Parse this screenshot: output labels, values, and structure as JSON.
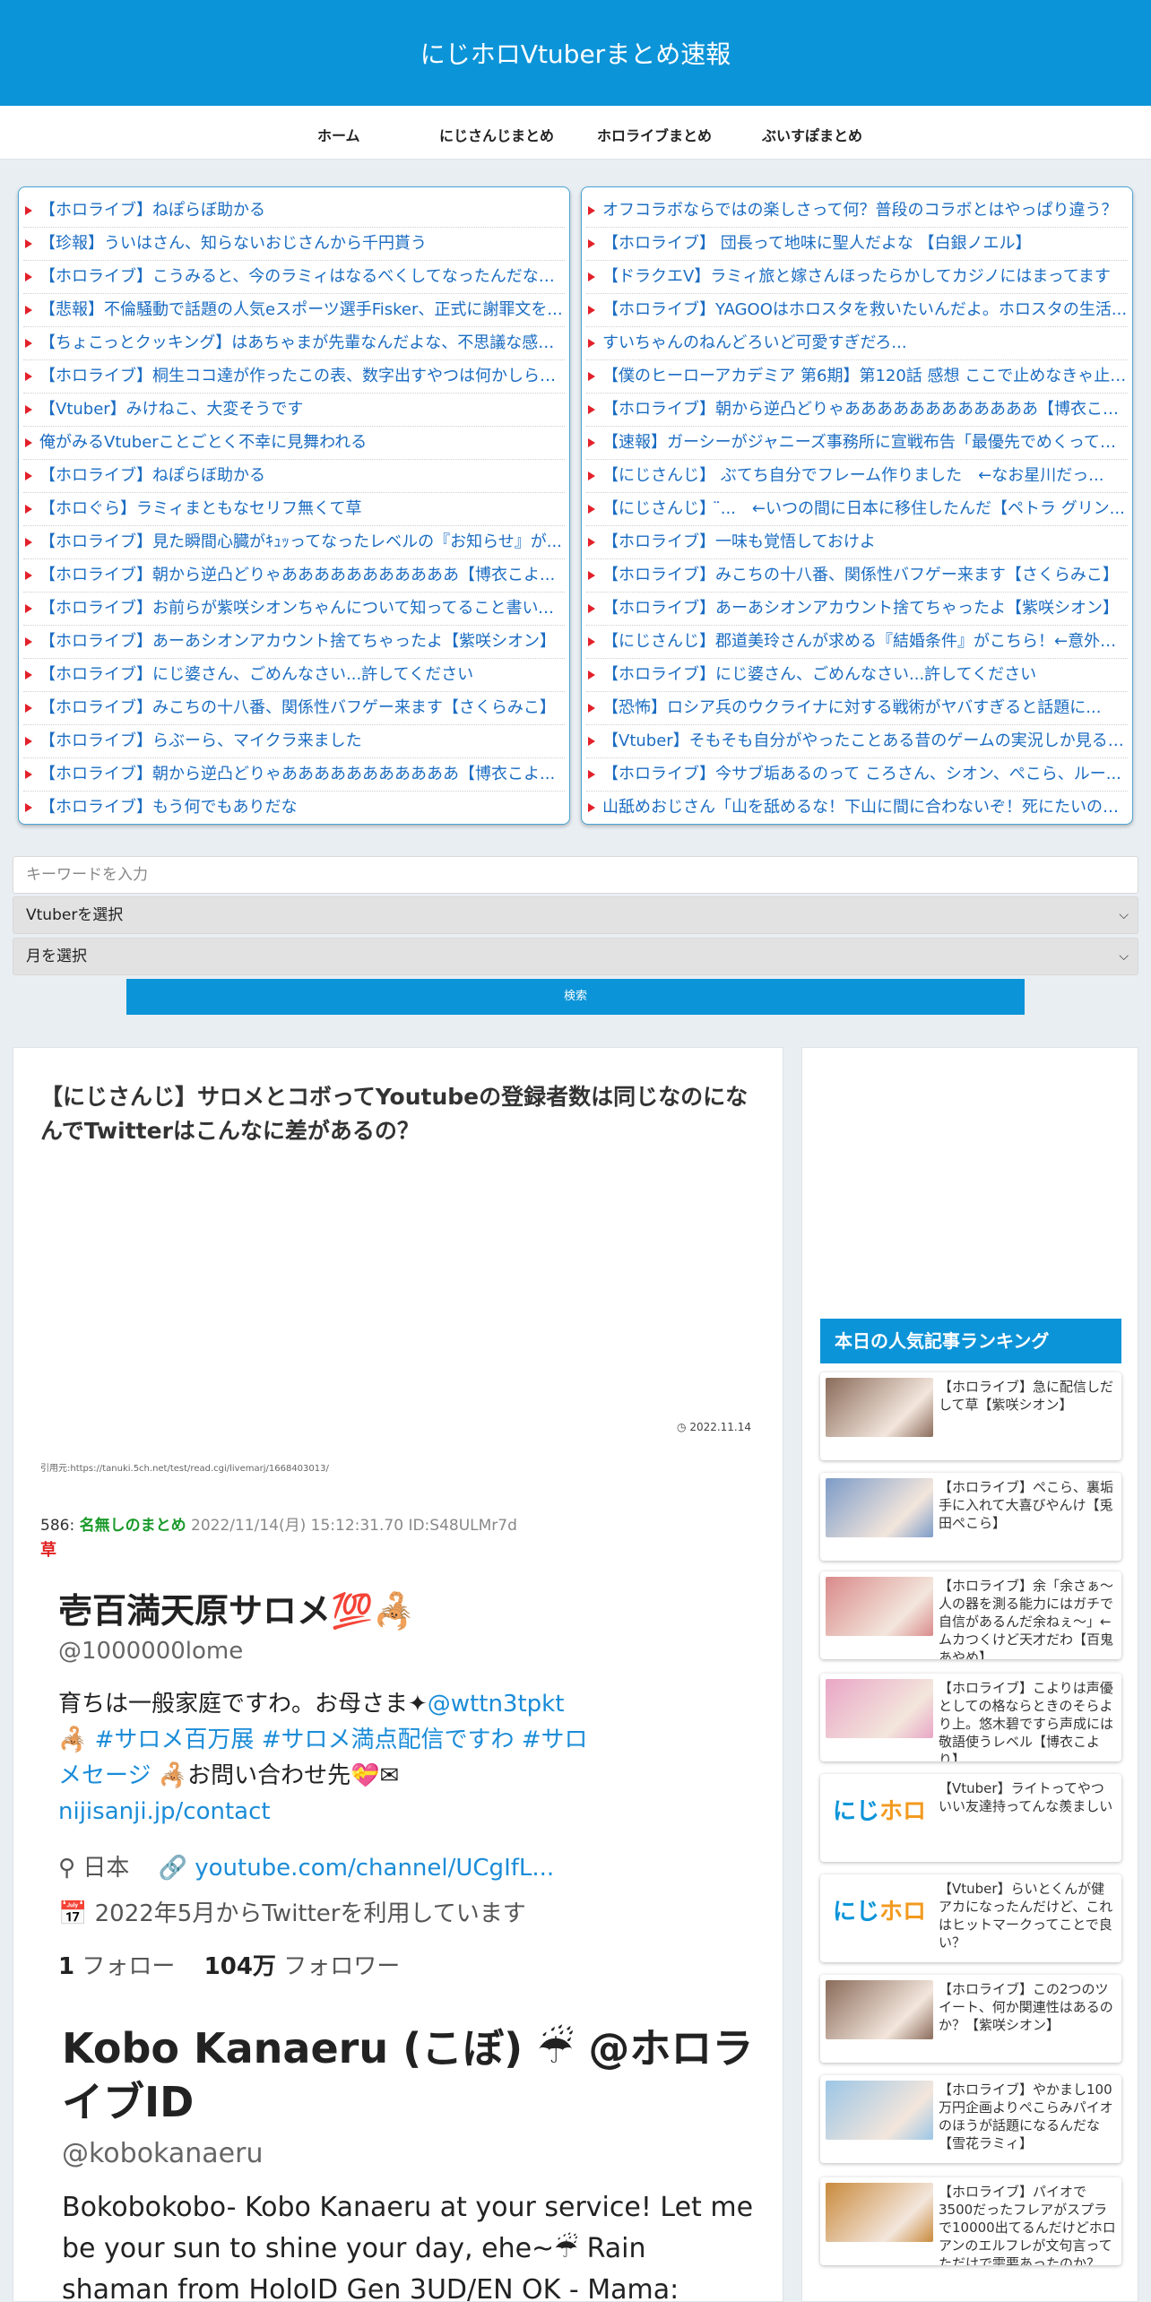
{
  "site_title": "にじホロVtuberまとめ速報",
  "nav": [
    "ホーム",
    "にじさんじまとめ",
    "ホロライブまとめ",
    "ぶいすぽまとめ"
  ],
  "left_links": [
    "【ホロライブ】ねぽらぼ助かる",
    "【珍報】ういはさん、知らないおじさんから千円貰う",
    "【ホロライブ】こうみると、今のラミィはなるべくしてなったんだなぁ...",
    "【悲報】不倫騒動で話題の人気eスポーツ選手Fisker、正式に謝罪文を...",
    "【ちょこっとクッキング】はあちゃまが先輩なんだよな、不思議な感覚...",
    "【ホロライブ】桐生ココ達が作ったこの表、数字出すやつは何かしら振...",
    "【Vtuber】みけねこ、大変そうです",
    "俺がみるVtuberことごとく不幸に見舞われる",
    "【ホロライブ】ねぽらぼ助かる",
    "【ホロぐら】ラミィまともなセリフ無くて草",
    "【ホロライブ】見た瞬間心臓がｷｭｯってなったレベルの『お知らせ』が...",
    "【ホロライブ】朝から逆凸どりゃあああああああああああ【博衣こよ...",
    "【ホロライブ】お前らが紫咲シオンちゃんについて知ってること書いて...",
    "【ホロライブ】あーあシオンアカウント捨てちゃったよ【紫咲シオン】",
    "【ホロライブ】にじ婆さん、ごめんなさい...許してください",
    "【ホロライブ】みこちの十八番、関係性バフゲー来ます【さくらみこ】",
    "【ホロライブ】らぶーら、マイクラ来ました",
    "【ホロライブ】朝から逆凸どりゃあああああああああああ【博衣こよ...",
    "【ホロライブ】もう何でもありだな"
  ],
  "right_links": [
    "オフコラボならではの楽しさって何？普段のコラボとはやっぱり違う？",
    "【ホロライブ】 団長って地味に聖人だよな 【白銀ノエル】",
    "【ドラクエV】ラミィ旅と嫁さんほったらかしてカジノにはまってます",
    "【ホロライブ】YAGOOはホロスタを救いたいんだよ。ホロスタの生活...",
    "すいちゃんのねんどろいど可愛すぎだろ...",
    "【僕のヒーローアカデミア 第6期】第120話 感想 ここで止めなきゃ止ま...",
    "【ホロライブ】朝から逆凸どりゃああああああああああああ【博衣こよ...",
    "【速報】ガーシーがジャニーズ事務所に宣戦布告「最優先でめくってい...",
    "【にじさんじ】 ぶてち自分でフレーム作りました　←なお星川だっ...",
    "【にじさんじ】 ̈...　←いつの間に日本に移住したんだ【ペトラ グリン...",
    "【ホロライブ】一味も覚悟しておけよ",
    "【ホロライブ】みこちの十八番、関係性バフゲー来ます【さくらみこ】",
    "【ホロライブ】あーあシオンアカウント捨てちゃったよ【紫咲シオン】",
    "【にじさんじ】郡道美玲さんが求める『結婚条件』がこちら！←意外に...",
    "【ホロライブ】にじ婆さん、ごめんなさい...許してください",
    "【恐怖】ロシア兵のウクライナに対する戦術がヤバすぎると話題に...",
    "【Vtuber】そもそも自分がやったことある昔のゲームの実況しか見る気...",
    "【ホロライブ】今サブ垢あるのって ころさん、シオン、ぺこら、ルー...",
    "山舐めおじさん「山を舐めるな！下山に間に合わないぞ！死にたいのか..."
  ],
  "search": {
    "keyword_placeholder": "キーワードを入力",
    "vtuber_select": "Vtuberを選択",
    "month_select": "月を選択",
    "button": "検索"
  },
  "article": {
    "title": "【にじさんじ】サロメとコボってYoutubeの登録者数は同じなのになんでTwitterはこんなに差があるの？",
    "date": "2022.11.14",
    "source_label": "引用元:",
    "source_url": "https://tanuki.5ch.net/test/read.cgi/livemarj/1668403013/",
    "post_num": "586:",
    "post_name": "名無しのまとめ",
    "post_meta": "2022/11/14(月) 15:12:31.70 ID:S48ULMr7d",
    "post_body": "草"
  },
  "tweet1": {
    "name": "壱百満天原サロメ💯🦂",
    "handle": "@1000000lome",
    "bio_1": "育ちは一般家庭ですわ。お母さま✦",
    "bio_link1": "@wttn3tpkt",
    "bio_2": "🦂 ",
    "bio_tags": "#サロメ百万展 #サロメ満点配信ですわ #サロメセージ",
    "bio_3": " 🦂お問い合わせ先💝✉ ",
    "bio_link2": "nijisanji.jp/contact",
    "location": "日本",
    "url": "youtube.com/channel/UCgIfL...",
    "joined": "2022年5月からTwitterを利用しています",
    "following_count": "1",
    "following_label": "フォロー",
    "followers_count": "104万",
    "followers_label": "フォロワー"
  },
  "tweet2": {
    "name": "Kobo Kanaeru (こぼ) ☔ @ホロライブID",
    "handle": "@kobokanaeru",
    "bio": "Bokobokobo- Kobo Kanaeru at your service! Let me be your sun to shine your day, ehe~☔ Rain shaman from HoloID Gen 3UD/EN OK - Mama:"
  },
  "sidebar": {
    "ranking_title": "本日の人気記事ランキング",
    "items": [
      {
        "title": "【ホロライブ】急に配信しだして草【紫咲シオン】",
        "thumb": "#8a6b5a"
      },
      {
        "title": "【ホロライブ】ぺこら、裏垢手に入れて大喜びやんけ【兎田ぺこら】",
        "thumb": "#7c9bc8"
      },
      {
        "title": "【ホロライブ】余「余さぁ～　人の器を測る能力にはガチで自信があるんだ余ねぇ～」←ムカつくけど天才だわ【百鬼あやめ】",
        "thumb": "#d98a8a"
      },
      {
        "title": "【ホロライブ】こよりは声優としての格ならときのそらより上。悠木碧ですら声成には敬語使うレベル【博衣こより】",
        "thumb": "#e9a6c6"
      },
      {
        "title": "【Vtuber】ライトってやつ いい友達持ってんな羨ましい",
        "thumb": "logo"
      },
      {
        "title": "【Vtuber】らいとくんが健アカになったんだけど、これはヒットマークってことで良い？",
        "thumb": "logo"
      },
      {
        "title": "【ホロライブ】この2つのツイート、何か関連性はあるのか？【紫咲シオン】",
        "thumb": "#8a6b5a"
      },
      {
        "title": "【ホロライブ】やかまし100万円企画よりぺこらみパイオのほうが話題になるんだな【雪花ラミィ】",
        "thumb": "#9cc6e6"
      },
      {
        "title": "【ホロライブ】パイオで3500だったフレアがスプラで10000出てるんだけどホロアンのエルフレが文句言ってただけで需要あったのか？【不知火フレア】",
        "thumb": "#c98a3c"
      }
    ],
    "logo_a": "にじ",
    "logo_b": "ホロ"
  }
}
